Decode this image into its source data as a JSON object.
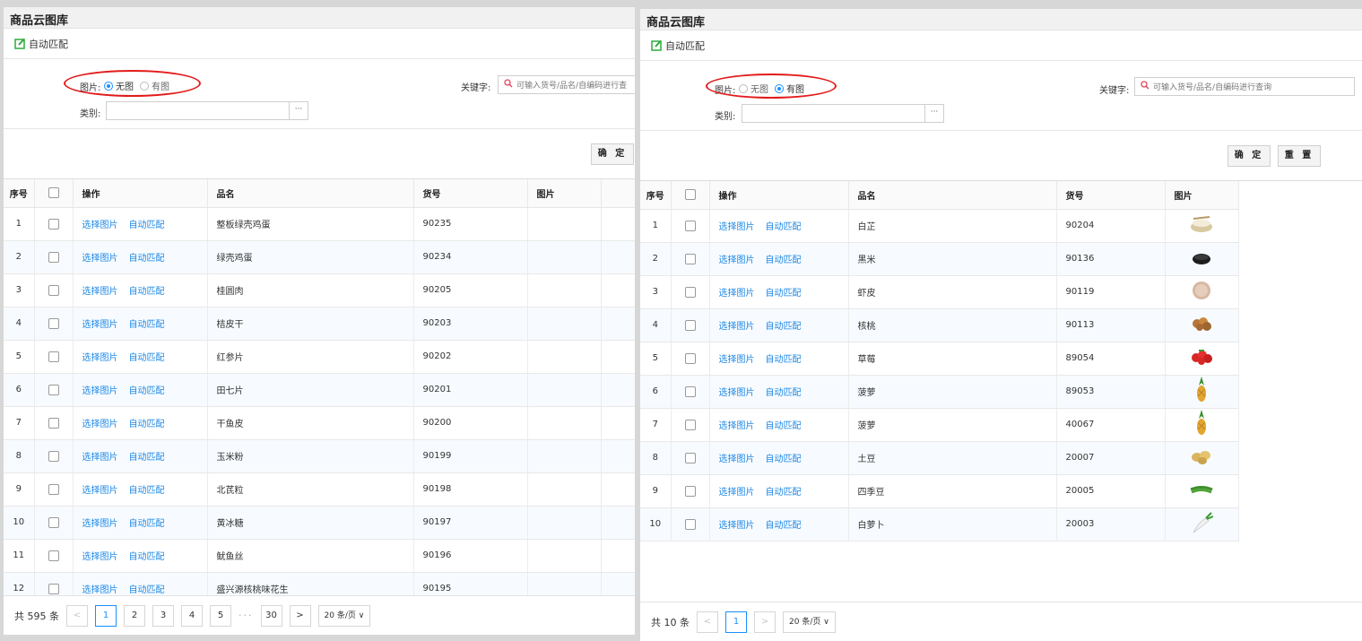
{
  "left": {
    "title": "商品云图库",
    "auto_match": "自动匹配",
    "image_filter": {
      "label": "图片:",
      "options": [
        "无图",
        "有图"
      ],
      "selected": 0
    },
    "keyword": {
      "label": "关键字:",
      "placeholder": "可输入货号/品名/自编码进行查"
    },
    "category": {
      "label": "类别:",
      "more": "···"
    },
    "confirm": "确 定",
    "columns": [
      "序号",
      "操作",
      "品名",
      "货号",
      "图片"
    ],
    "action_select": "选择图片",
    "action_auto": "自动匹配",
    "rows": [
      {
        "idx": "1",
        "name": "整板绿壳鸡蛋",
        "code": "90235"
      },
      {
        "idx": "2",
        "name": "绿壳鸡蛋",
        "code": "90234"
      },
      {
        "idx": "3",
        "name": "桂圆肉",
        "code": "90205"
      },
      {
        "idx": "4",
        "name": "桔皮干",
        "code": "90203"
      },
      {
        "idx": "5",
        "name": "红参片",
        "code": "90202"
      },
      {
        "idx": "6",
        "name": "田七片",
        "code": "90201"
      },
      {
        "idx": "7",
        "name": "干鱼皮",
        "code": "90200"
      },
      {
        "idx": "8",
        "name": "玉米粉",
        "code": "90199"
      },
      {
        "idx": "9",
        "name": "北芪粒",
        "code": "90198"
      },
      {
        "idx": "10",
        "name": "黄冰糖",
        "code": "90197"
      },
      {
        "idx": "11",
        "name": "鱿鱼丝",
        "code": "90196"
      },
      {
        "idx": "12",
        "name": "盛兴源核桃味花生",
        "code": "90195"
      }
    ],
    "pager": {
      "total": "共 595 条",
      "prev": "<",
      "pages": [
        "1",
        "2",
        "3",
        "4",
        "5"
      ],
      "dots": "···",
      "last": "30",
      "next": ">",
      "size": "20 条/页"
    }
  },
  "right": {
    "title": "商品云图库",
    "auto_match": "自动匹配",
    "image_filter": {
      "label": "图片:",
      "options": [
        "无图",
        "有图"
      ],
      "selected": 1
    },
    "keyword": {
      "label": "关键字:",
      "placeholder": "可输入货号/品名/自编码进行查询"
    },
    "category": {
      "label": "类别:",
      "more": "···"
    },
    "confirm": "确 定",
    "reset": "重 置",
    "columns": [
      "序号",
      "操作",
      "品名",
      "货号",
      "图片"
    ],
    "action_select": "选择图片",
    "action_auto": "自动匹配",
    "rows": [
      {
        "idx": "1",
        "name": "白芷",
        "code": "90204",
        "img": "herb-bowl"
      },
      {
        "idx": "2",
        "name": "黑米",
        "code": "90136",
        "img": "black-rice"
      },
      {
        "idx": "3",
        "name": "虾皮",
        "code": "90119",
        "img": "dried-shrimp"
      },
      {
        "idx": "4",
        "name": "核桃",
        "code": "90113",
        "img": "walnut"
      },
      {
        "idx": "5",
        "name": "草莓",
        "code": "89054",
        "img": "strawberry"
      },
      {
        "idx": "6",
        "name": "菠萝",
        "code": "89053",
        "img": "pineapple"
      },
      {
        "idx": "7",
        "name": "菠萝",
        "code": "40067",
        "img": "pineapple"
      },
      {
        "idx": "8",
        "name": "土豆",
        "code": "20007",
        "img": "potato"
      },
      {
        "idx": "9",
        "name": "四季豆",
        "code": "20005",
        "img": "green-bean"
      },
      {
        "idx": "10",
        "name": "白萝卜",
        "code": "20003",
        "img": "radish"
      }
    ],
    "pager": {
      "total": "共 10 条",
      "prev": "<",
      "pages": [
        "1"
      ],
      "next": ">",
      "size": "20 条/页"
    }
  },
  "colors": {
    "accent": "#1890ff",
    "link": "#1e88e5",
    "highlight": "#e21b1b",
    "edit_icon": "#2eaa3c"
  }
}
